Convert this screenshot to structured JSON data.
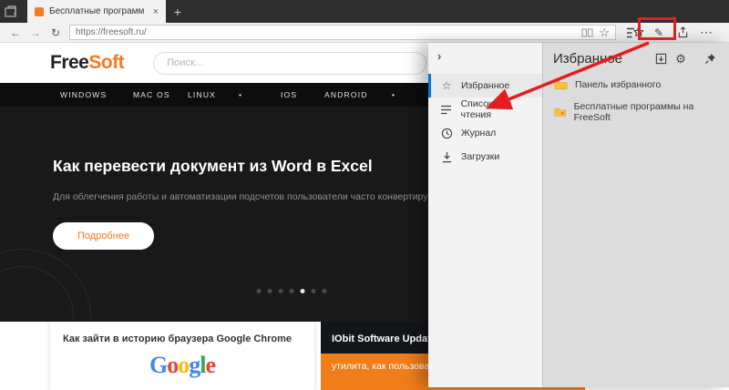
{
  "colors": {
    "accent_orange": "#f47b20",
    "edge_blue": "#0078d7",
    "annotation_red": "#e31e1e"
  },
  "browser": {
    "tab_title": "Бесплатные программ",
    "tab_close": "×",
    "new_tab_button": "+",
    "back": "←",
    "forward": "→",
    "refresh": "↻",
    "address_url": "https://freesoft.ru/",
    "favorite_star": "☆",
    "more_button": "⋯"
  },
  "site": {
    "logo_free": "Free",
    "logo_soft": "Soft",
    "search_placeholder": "Поиск...",
    "nav_items": [
      "WINDOWS",
      "MAC OS",
      "LINUX",
      "•",
      "IOS",
      "ANDROID",
      "•"
    ],
    "hero_title": "Как перевести документ из Word в Excel",
    "hero_subtitle": "Для облегчения работы и автоматизации подсчетов пользователи часто конвертируют файлы из одн",
    "hero_button": "Подробнее",
    "card_left_title": "Как зайти в историю браузера Google Chrome",
    "google_letters": [
      "G",
      "o",
      "o",
      "g",
      "l",
      "e"
    ],
    "card_right_title": "IObit Software Updater",
    "card_right_subtitle": "утилита, как пользова"
  },
  "hub": {
    "chevron": "›",
    "menu": [
      {
        "label": "Избранное",
        "selected": true
      },
      {
        "label": "Список для чтения",
        "selected": false
      },
      {
        "label": "Журнал",
        "selected": false
      },
      {
        "label": "Загрузки",
        "selected": false
      }
    ]
  },
  "favorites": {
    "title": "Избранное",
    "gear": "⚙",
    "items": [
      {
        "label": "Панель избранного"
      },
      {
        "label": "Бесплатные программы на FreeSoft"
      }
    ]
  }
}
